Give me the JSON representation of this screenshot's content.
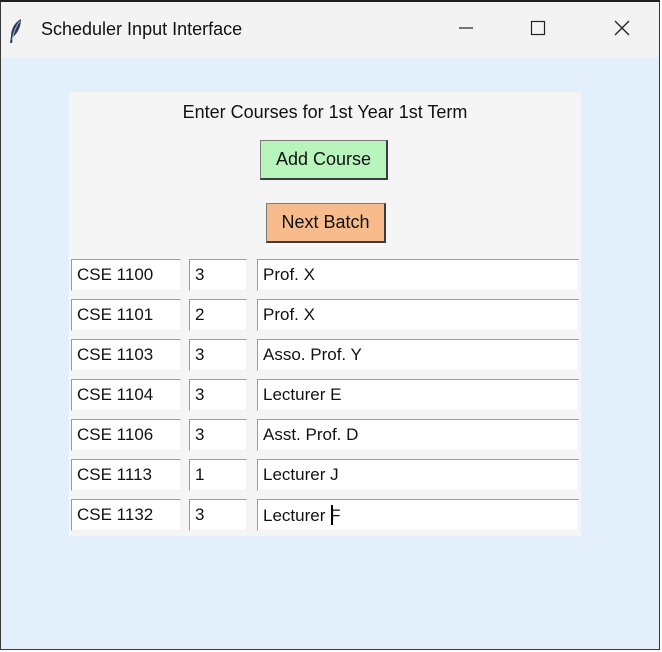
{
  "window": {
    "title": "Scheduler Input Interface",
    "controls": {
      "minimize": "minimize-icon",
      "maximize": "maximize-icon",
      "close": "close-icon"
    }
  },
  "form": {
    "heading": "Enter Courses for 1st Year 1st Term",
    "add_course_label": "Add Course",
    "next_batch_label": "Next Batch",
    "add_course_color": "#b8f5bd",
    "next_batch_color": "#f8bc8c"
  },
  "courses": [
    {
      "code": "CSE 1100",
      "credit": "3",
      "teacher": "Prof. X"
    },
    {
      "code": "CSE 1101",
      "credit": "2",
      "teacher": "Prof. X"
    },
    {
      "code": "CSE 1103",
      "credit": "3",
      "teacher": "Asso. Prof. Y"
    },
    {
      "code": "CSE 1104",
      "credit": "3",
      "teacher": "Lecturer E"
    },
    {
      "code": "CSE 1106",
      "credit": "3",
      "teacher": "Asst. Prof. D"
    },
    {
      "code": "CSE 1113",
      "credit": "1",
      "teacher": "Lecturer J"
    },
    {
      "code": "CSE 1132",
      "credit": "3",
      "teacher": "Lecturer F"
    }
  ],
  "colors": {
    "background": "#e4effc",
    "panel": "#f5f5f5",
    "titlebar": "#f3f3f3"
  }
}
